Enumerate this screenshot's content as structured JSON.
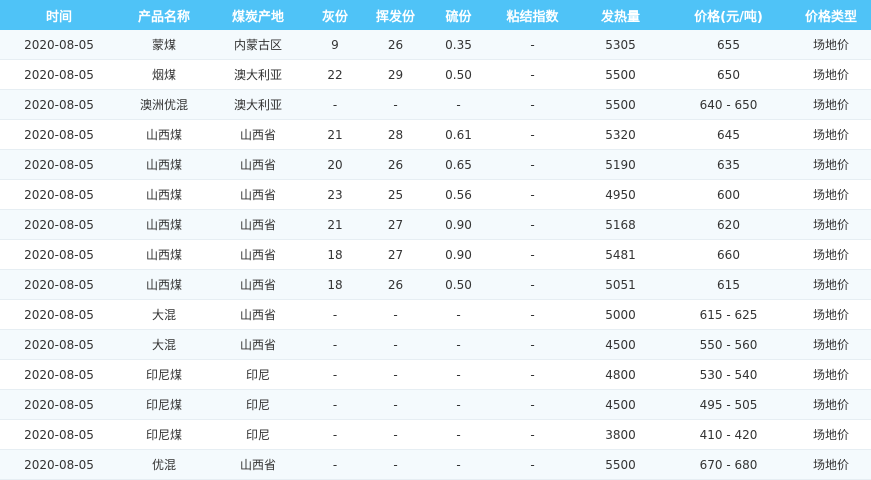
{
  "table": {
    "headers": [
      "时间",
      "产品名称",
      "煤炭产地",
      "灰份",
      "挥发份",
      "硫份",
      "粘结指数",
      "发热量",
      "价格(元/吨)",
      "价格类型"
    ],
    "rows": [
      [
        "2020-08-05",
        "蒙煤",
        "内蒙古区",
        "9",
        "26",
        "0.35",
        "-",
        "5305",
        "655",
        "场地价"
      ],
      [
        "2020-08-05",
        "烟煤",
        "澳大利亚",
        "22",
        "29",
        "0.50",
        "-",
        "5500",
        "650",
        "场地价"
      ],
      [
        "2020-08-05",
        "澳洲优混",
        "澳大利亚",
        "-",
        "-",
        "-",
        "-",
        "5500",
        "640 - 650",
        "场地价"
      ],
      [
        "2020-08-05",
        "山西煤",
        "山西省",
        "21",
        "28",
        "0.61",
        "-",
        "5320",
        "645",
        "场地价"
      ],
      [
        "2020-08-05",
        "山西煤",
        "山西省",
        "20",
        "26",
        "0.65",
        "-",
        "5190",
        "635",
        "场地价"
      ],
      [
        "2020-08-05",
        "山西煤",
        "山西省",
        "23",
        "25",
        "0.56",
        "-",
        "4950",
        "600",
        "场地价"
      ],
      [
        "2020-08-05",
        "山西煤",
        "山西省",
        "21",
        "27",
        "0.90",
        "-",
        "5168",
        "620",
        "场地价"
      ],
      [
        "2020-08-05",
        "山西煤",
        "山西省",
        "18",
        "27",
        "0.90",
        "-",
        "5481",
        "660",
        "场地价"
      ],
      [
        "2020-08-05",
        "山西煤",
        "山西省",
        "18",
        "26",
        "0.50",
        "-",
        "5051",
        "615",
        "场地价"
      ],
      [
        "2020-08-05",
        "大混",
        "山西省",
        "-",
        "-",
        "-",
        "-",
        "5000",
        "615 - 625",
        "场地价"
      ],
      [
        "2020-08-05",
        "大混",
        "山西省",
        "-",
        "-",
        "-",
        "-",
        "4500",
        "550 - 560",
        "场地价"
      ],
      [
        "2020-08-05",
        "印尼煤",
        "印尼",
        "-",
        "-",
        "-",
        "-",
        "4800",
        "530 - 540",
        "场地价"
      ],
      [
        "2020-08-05",
        "印尼煤",
        "印尼",
        "-",
        "-",
        "-",
        "-",
        "4500",
        "495 - 505",
        "场地价"
      ],
      [
        "2020-08-05",
        "印尼煤",
        "印尼",
        "-",
        "-",
        "-",
        "-",
        "3800",
        "410 - 420",
        "场地价"
      ],
      [
        "2020-08-05",
        "优混",
        "山西省",
        "-",
        "-",
        "-",
        "-",
        "5500",
        "670 - 680",
        "场地价"
      ]
    ]
  },
  "colors": {
    "header_bg": "#4fc3f7",
    "header_text": "#ffffff",
    "row_alt_bg": "#f4fafd",
    "row_bg": "#ffffff",
    "cell_text": "#333333"
  }
}
